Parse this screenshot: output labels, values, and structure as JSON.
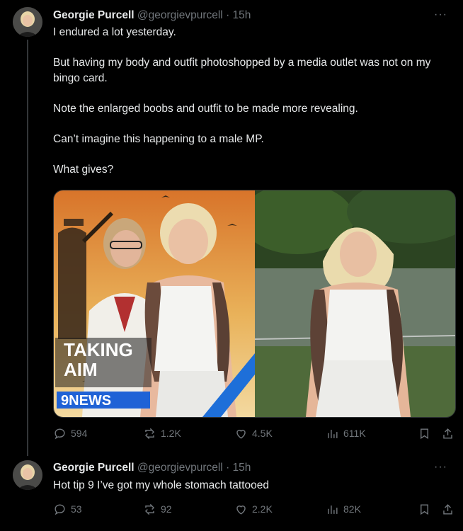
{
  "tweets": [
    {
      "author": {
        "name": "Georgie Purcell",
        "handle": "@georgievpurcell",
        "time": "15h"
      },
      "paragraphs": [
        "I endured a lot yesterday.",
        "But having my body and outfit photoshopped by a media outlet was not on my bingo card.",
        "Note the enlarged boobs and outfit to be made more revealing.",
        "Can’t imagine this happening to a male MP.",
        "What gives?"
      ],
      "media": {
        "left_caption_line1": "TAKING",
        "left_caption_line2": "AIM",
        "left_logo": "9NEWS"
      },
      "stats": {
        "replies": "594",
        "reposts": "1.2K",
        "likes": "4.5K",
        "views": "611K"
      }
    },
    {
      "author": {
        "name": "Georgie Purcell",
        "handle": "@georgievpurcell",
        "time": "15h"
      },
      "text": "Hot tip 9 I’ve got my whole stomach tattooed",
      "stats": {
        "replies": "53",
        "reposts": "92",
        "likes": "2.2K",
        "views": "82K"
      }
    }
  ],
  "ui": {
    "more_label": "···",
    "dot": "·"
  },
  "colors": {
    "background": "#000000",
    "text": "#e7e9ea",
    "secondary": "#71767b",
    "divider": "#2f3336"
  }
}
